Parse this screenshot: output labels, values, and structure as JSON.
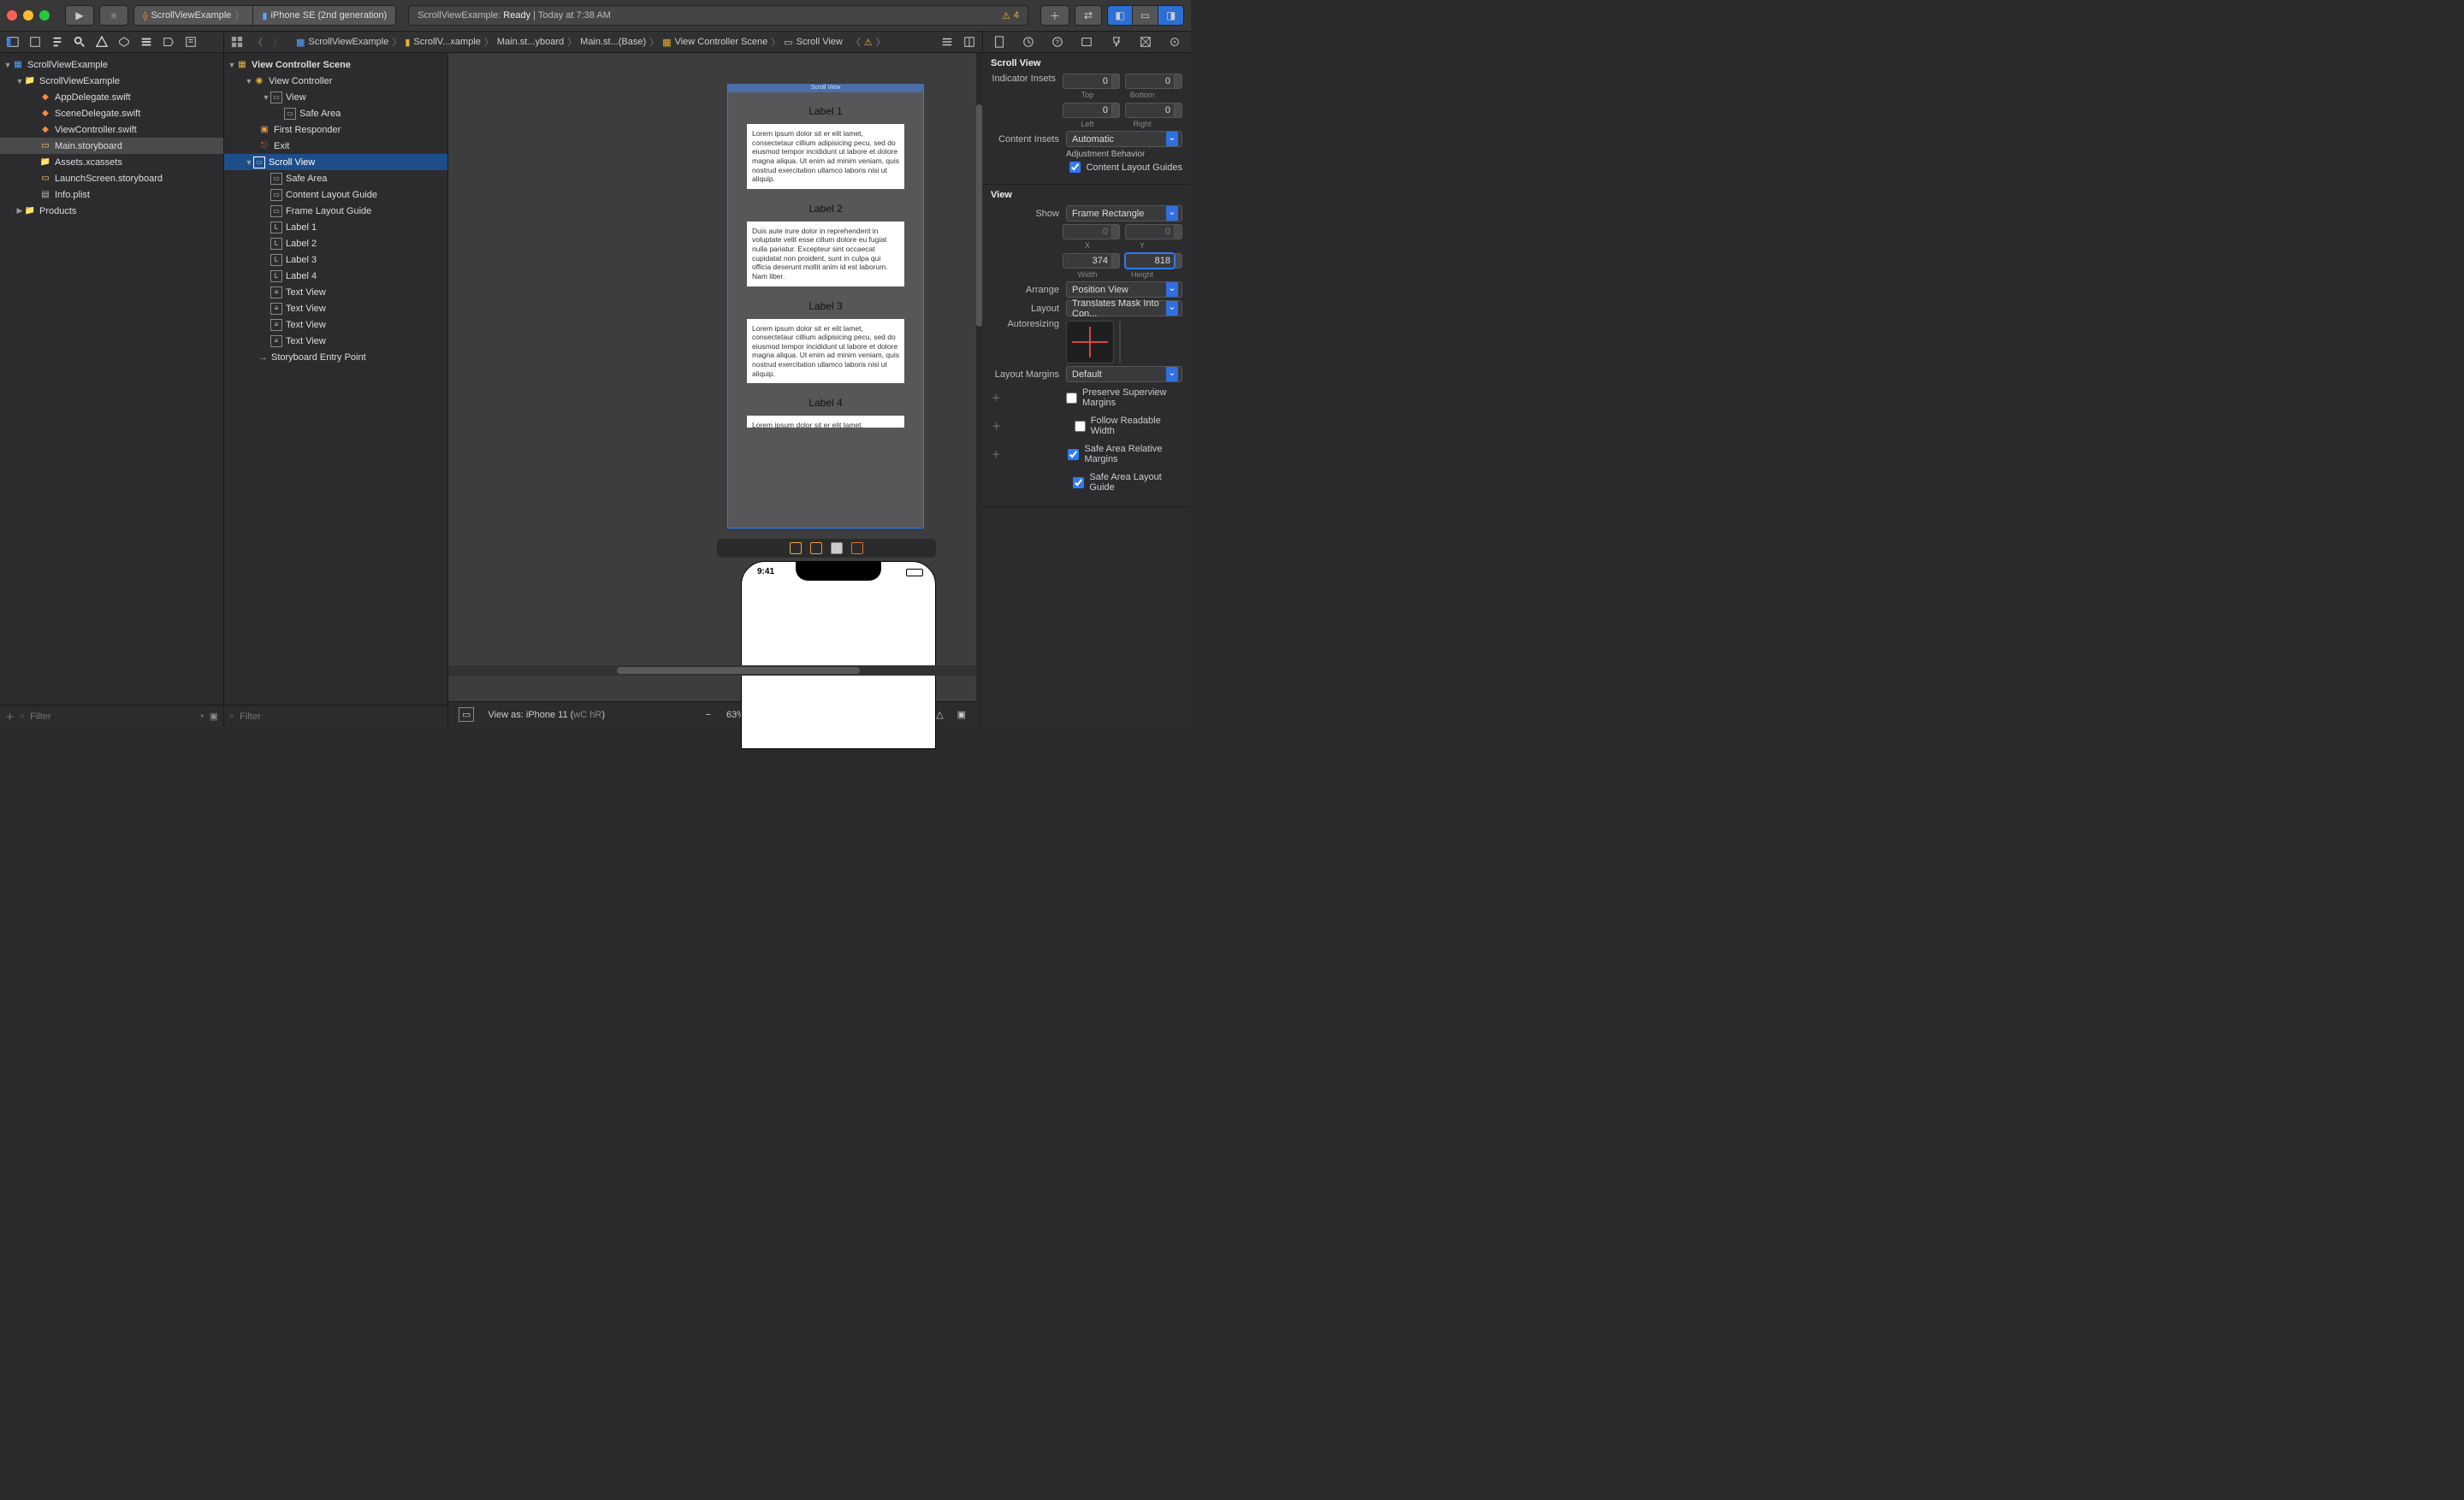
{
  "titlebar": {
    "scheme_project": "ScrollViewExample",
    "scheme_device": "iPhone SE (2nd generation)",
    "status_prefix": "ScrollViewExample: ",
    "status_state": "Ready",
    "status_sep": " | ",
    "status_time": "Today at 7:38 AM",
    "warn_count": "4"
  },
  "breadcrumb": {
    "items": [
      "ScrollViewExample",
      "ScrollV...xample",
      "Main.st...yboard",
      "Main.st...(Base)",
      "View Controller Scene",
      "Scroll View"
    ]
  },
  "project_navigator": {
    "root": "ScrollViewExample",
    "group": "ScrollViewExample",
    "files": [
      {
        "name": "AppDelegate.swift",
        "kind": "swift"
      },
      {
        "name": "SceneDelegate.swift",
        "kind": "swift"
      },
      {
        "name": "ViewController.swift",
        "kind": "swift"
      },
      {
        "name": "Main.storyboard",
        "kind": "storyboard",
        "selected": true
      },
      {
        "name": "Assets.xcassets",
        "kind": "folder"
      },
      {
        "name": "LaunchScreen.storyboard",
        "kind": "storyboard"
      },
      {
        "name": "Info.plist",
        "kind": "plist"
      }
    ],
    "products": "Products",
    "filter_placeholder": "Filter"
  },
  "outline": {
    "scene": "View Controller Scene",
    "vc": "View Controller",
    "view": "View",
    "safe1": "Safe Area",
    "first_responder": "First Responder",
    "exit": "Exit",
    "scrollview": "Scroll View",
    "sv_children": [
      "Safe Area",
      "Content Layout Guide",
      "Frame Layout Guide",
      "Label 1",
      "Label 2",
      "Label 3",
      "Label 4",
      "Text View",
      "Text View",
      "Text View",
      "Text View"
    ],
    "entry": "Storyboard Entry Point",
    "filter_placeholder": "Filter"
  },
  "canvas": {
    "scrollview_label": "Scroll View",
    "labels": [
      "Label 1",
      "Label 2",
      "Label 3",
      "Label 4"
    ],
    "lorem1": "Lorem ipsum dolor sit er elit lamet, consectetaur cillium adipisicing pecu, sed do eiusmod tempor incididunt ut labore et dolore magna aliqua. Ut enim ad minim veniam, quis nostrud exercitation ullamco laboris nisi ut aliquip.",
    "lorem2": "Duis aute irure dolor in reprehenderit in voluptate velit esse cillum dolore eu fugiat nulla pariatur. Excepteur sint occaecat cupidatat non proident, sunt in culpa qui officia deserunt mollit anim id est laborum. Nam liber.",
    "lorem3_short": "Lorem ipsum dolor sit er elit lamet,",
    "phone_time": "9:41",
    "bottom": {
      "viewas": "View as: iPhone 11 (",
      "traits": "wC hR",
      "close": ")",
      "zoom": "63%"
    }
  },
  "inspector": {
    "scrollview_head": "Scroll View",
    "indicator_label": "Indicator Insets",
    "insets": {
      "top": "0",
      "bottom": "0",
      "left": "0",
      "right": "0"
    },
    "inset_sub": {
      "top": "Top",
      "bottom": "Bottom",
      "left": "Left",
      "right": "Right"
    },
    "content_insets_label": "Content Insets",
    "content_insets_value": "Automatic",
    "adjustment_label": "Adjustment Behavior",
    "content_guides": "Content Layout Guides",
    "view_head": "View",
    "show_label": "Show",
    "show_value": "Frame Rectangle",
    "xy": {
      "x": "0",
      "y": "0",
      "xl": "X",
      "yl": "Y"
    },
    "wh": {
      "w": "374",
      "h": "818",
      "wl": "Width",
      "hl": "Height"
    },
    "arrange_label": "Arrange",
    "arrange_value": "Position View",
    "layout_label": "Layout",
    "layout_value": "Translates Mask Into Con...",
    "autoresizing_label": "Autoresizing",
    "lm_label": "Layout Margins",
    "lm_value": "Default",
    "preserve": "Preserve Superview Margins",
    "readable": "Follow Readable Width",
    "safe_rel": "Safe Area Relative Margins",
    "safe_guide": "Safe Area Layout Guide"
  }
}
